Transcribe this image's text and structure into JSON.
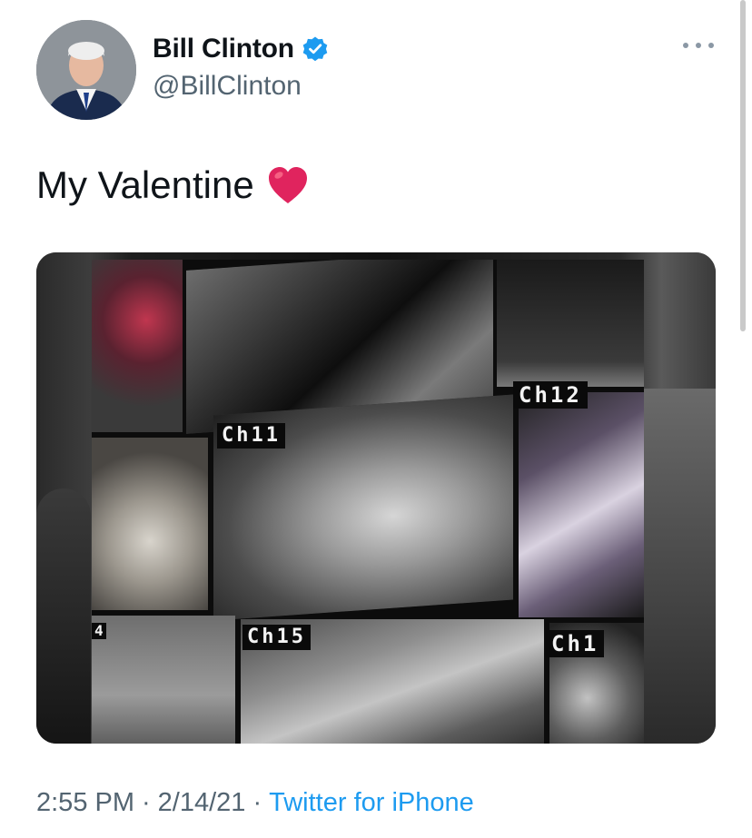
{
  "author": {
    "display_name": "Bill Clinton",
    "handle": "@BillClinton",
    "verified": true,
    "avatar_icon": "profile-photo"
  },
  "tweet": {
    "text": "My Valentine",
    "emoji_icon": "red-heart-icon",
    "media": {
      "description_icon": "cctv-monitor-photo",
      "channel_labels": [
        "Ch12",
        "Ch11",
        "Ch15",
        "Ch1",
        "4"
      ]
    }
  },
  "meta": {
    "time": "2:55 PM",
    "separator": "·",
    "date": "2/14/21",
    "source": "Twitter for iPhone"
  },
  "colors": {
    "text": "#0f1419",
    "secondary": "#536471",
    "link": "#1d9bf0",
    "heart": "#e0245e",
    "verified": "#1d9bf0"
  }
}
